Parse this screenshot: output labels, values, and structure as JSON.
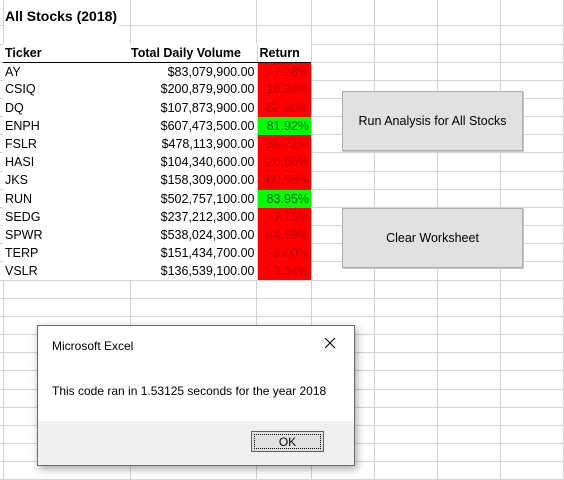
{
  "sheet": {
    "title": "All Stocks (2018)",
    "headers": {
      "ticker": "Ticker",
      "volume": "Total Daily Volume",
      "return": "Return"
    },
    "rows": [
      {
        "ticker": "AY",
        "volume": "$83,079,900.00",
        "return": "-7.28%",
        "positive": false
      },
      {
        "ticker": "CSIQ",
        "volume": "$200,879,900.00",
        "return": "-16.34%",
        "positive": false
      },
      {
        "ticker": "DQ",
        "volume": "$107,873,900.00",
        "return": "-62.60%",
        "positive": false
      },
      {
        "ticker": "ENPH",
        "volume": "$607,473,500.00",
        "return": "81.92%",
        "positive": true
      },
      {
        "ticker": "FSLR",
        "volume": "$478,113,900.00",
        "return": "-39.71%",
        "positive": false
      },
      {
        "ticker": "HASI",
        "volume": "$104,340,600.00",
        "return": "-20.66%",
        "positive": false
      },
      {
        "ticker": "JKS",
        "volume": "$158,309,000.00",
        "return": "-60.53%",
        "positive": false
      },
      {
        "ticker": "RUN",
        "volume": "$502,757,100.00",
        "return": "83.95%",
        "positive": true
      },
      {
        "ticker": "SEDG",
        "volume": "$237,212,300.00",
        "return": "-7.75%",
        "positive": false
      },
      {
        "ticker": "SPWR",
        "volume": "$538,024,300.00",
        "return": "-44.59%",
        "positive": false
      },
      {
        "ticker": "TERP",
        "volume": "$151,434,700.00",
        "return": "-5.00%",
        "positive": false
      },
      {
        "ticker": "VSLR",
        "volume": "$136,539,100.00",
        "return": "-3.54%",
        "positive": false
      }
    ]
  },
  "buttons": {
    "run_label": "Run Analysis for All Stocks",
    "clear_label": "Clear Worksheet"
  },
  "dialog": {
    "title": "Microsoft Excel",
    "message": "This code ran in 1.53125 seconds for the year 2018",
    "ok_label": "OK",
    "close_icon": "close-icon"
  },
  "colors": {
    "negative_fill": "#ff0000",
    "positive_fill": "#00ff00",
    "gridline": "#d4d4d4"
  }
}
